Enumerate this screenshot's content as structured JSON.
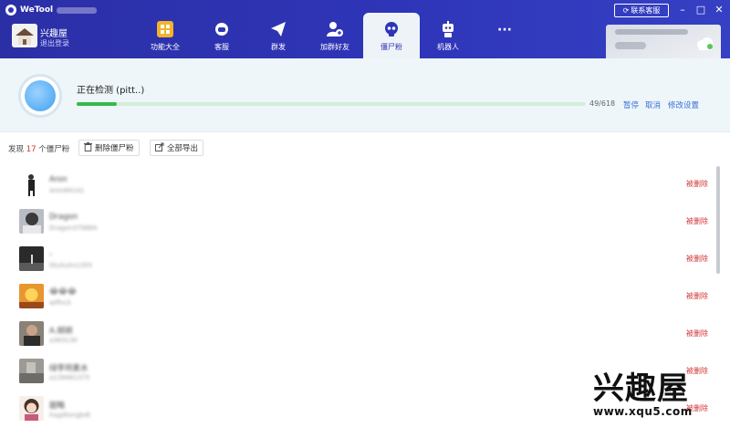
{
  "app": {
    "title": "WeTool"
  },
  "user": {
    "name": "兴趣屋",
    "logout_label": "退出登录"
  },
  "nav": [
    {
      "label": "功能大全",
      "icon": "grid-icon"
    },
    {
      "label": "客服",
      "icon": "headset-icon"
    },
    {
      "label": "群发",
      "icon": "paper-plane-icon"
    },
    {
      "label": "加群好友",
      "icon": "add-friend-icon"
    },
    {
      "label": "僵尸粉",
      "icon": "skull-icon",
      "active": true
    },
    {
      "label": "机器人",
      "icon": "robot-icon"
    },
    {
      "label": "···",
      "icon": "more-icon"
    }
  ],
  "header": {
    "contact_label": "联系客服"
  },
  "scan": {
    "status": "正在检测 (pitt..)",
    "progress": 0.0793,
    "progress_text": "49/618",
    "pause_label": "暂停",
    "cancel_label": "取消",
    "settings_label": "修改设置"
  },
  "toolbar": {
    "found_prefix": "发现",
    "found_count": "17",
    "found_suffix": "个僵尸粉",
    "delete_label": "删除僵尸粉",
    "export_label": "全部导出"
  },
  "contacts": [
    {
      "name": "Aron",
      "id": "Aron84141",
      "status": "被删除"
    },
    {
      "name": "Dragon",
      "id": "Dragon379884",
      "status": "被删除"
    },
    {
      "name": "-",
      "id": "liliuliu0v1355",
      "status": "被删除"
    },
    {
      "name": "😂😂😂",
      "id": "wlfhn3",
      "status": "被删除"
    },
    {
      "name": "A.胡胡",
      "id": "a363130",
      "status": "被删除"
    },
    {
      "name": "绿李珂素水",
      "id": "a139461375",
      "status": "被删除"
    },
    {
      "name": "甜略",
      "id": "hagdtengbdt",
      "status": "被删除"
    }
  ],
  "watermark": {
    "big": "兴趣屋",
    "url": "www.xqu5.com"
  }
}
